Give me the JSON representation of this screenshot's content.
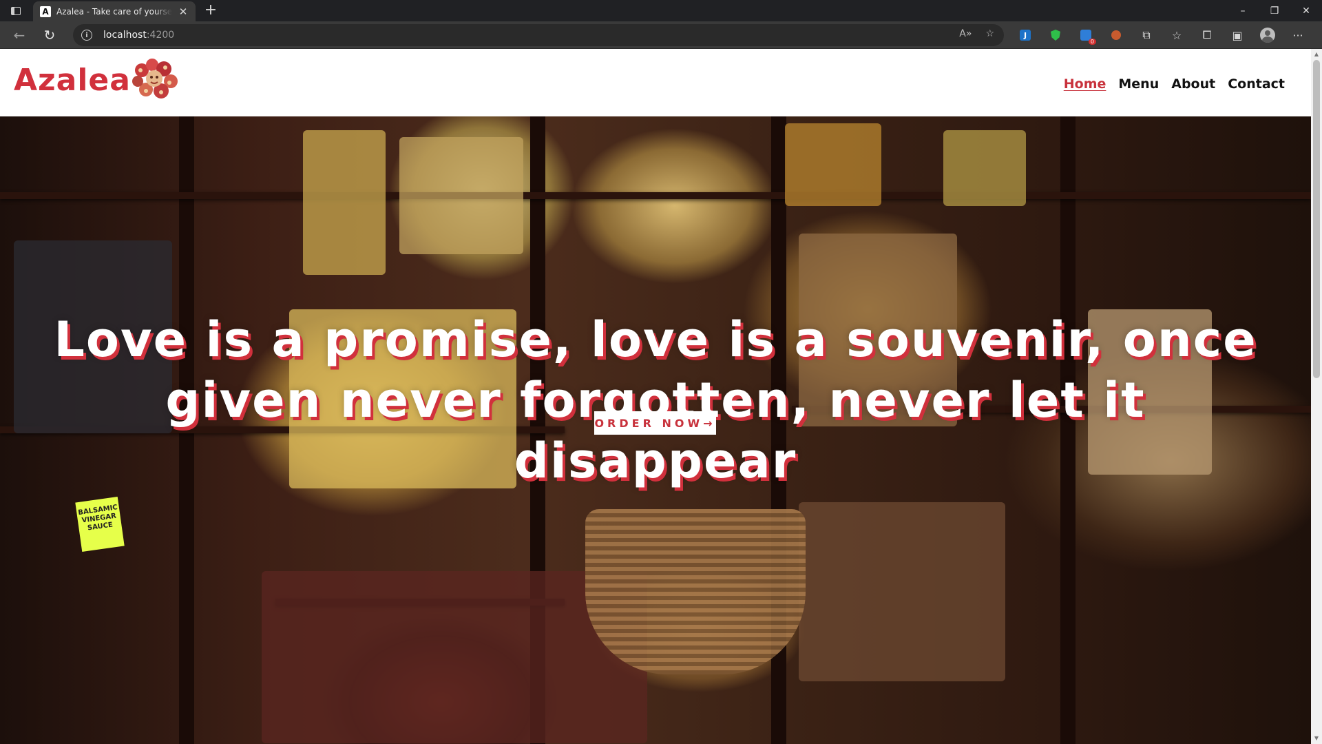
{
  "browser": {
    "tab_title": "Azalea - Take care of yourself fo",
    "tab_favicon": "A",
    "new_tab_icon": "+",
    "url_host": "localhost",
    "url_port": ":4200",
    "window_controls": [
      "–",
      "❐",
      "✕"
    ]
  },
  "site": {
    "brand": "Azalea",
    "nav": [
      {
        "label": "Home",
        "active": true
      },
      {
        "label": "Menu",
        "active": false
      },
      {
        "label": "About",
        "active": false
      },
      {
        "label": "Contact",
        "active": false
      }
    ],
    "hero": {
      "quote": "Love is a promise, love is a souvenir, once given never forgotten, never let it disappear",
      "cta": "ORDER NOW→",
      "sign_text": "BALSAMIC VINEGAR SAUCE"
    }
  },
  "colors": {
    "accent": "#d1303c",
    "text_dark": "#111111"
  }
}
